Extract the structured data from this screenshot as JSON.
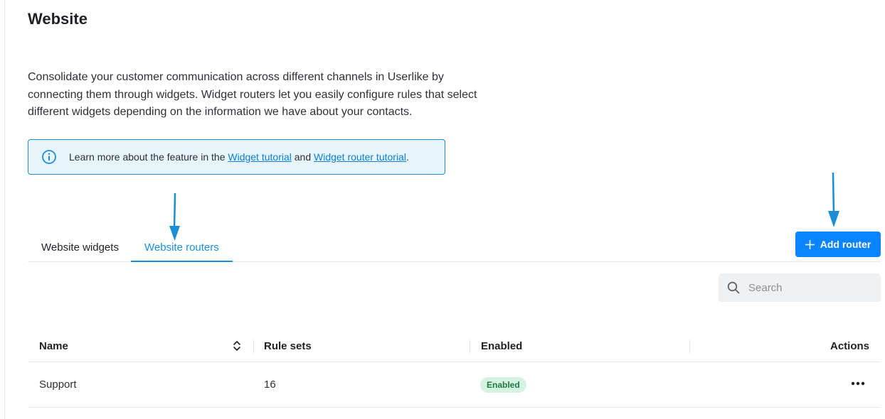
{
  "page": {
    "title": "Website",
    "description": "Consolidate your customer communication across different channels in Userlike by connecting them through widgets. Widget routers let you easily configure rules that select different widgets depending on the information we have about your contacts."
  },
  "info": {
    "prefix": "Learn more about the feature in the ",
    "link1": "Widget tutorial",
    "middle": " and ",
    "link2": "Widget router tutorial",
    "suffix": "."
  },
  "tabs": [
    {
      "label": "Website widgets",
      "active": false
    },
    {
      "label": "Website routers",
      "active": true
    }
  ],
  "toolbar": {
    "add_label": "Add router",
    "search_placeholder": "Search"
  },
  "table": {
    "columns": [
      "Name",
      "Rule sets",
      "Enabled",
      "Actions"
    ],
    "rows": [
      {
        "name": "Support",
        "rule_sets": "16",
        "enabled": "Enabled"
      }
    ]
  },
  "colors": {
    "accent": "#0a84ff",
    "tab_active": "#1a8fd8",
    "info_border": "#1a8fd8",
    "info_bg": "#e8f4fb",
    "badge_bg": "#d6f2e1",
    "badge_text": "#1d7a43"
  },
  "icons": [
    "info-icon",
    "plus-icon",
    "search-icon",
    "sort-icon",
    "more-icon",
    "arrow-down-icon"
  ]
}
